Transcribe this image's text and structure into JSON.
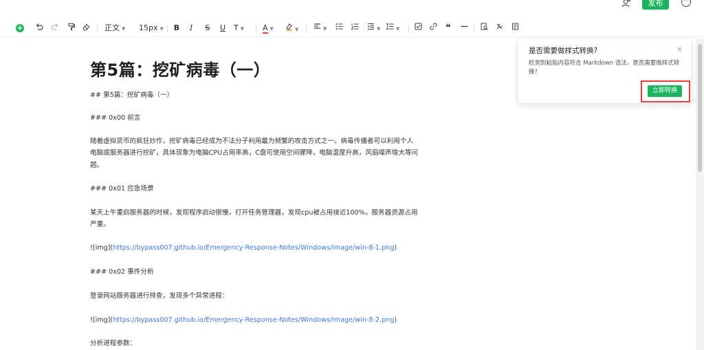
{
  "topbar": {
    "add_user_icon": "add-user-icon",
    "publish_label": "发布",
    "more_icon": "more-icon",
    "accent_color": "#1db45f"
  },
  "toolbar": {
    "insert_icon": "plus-circle-icon",
    "undo_icon": "undo-icon",
    "redo_icon": "redo-icon",
    "format_painter_icon": "format-painter-icon",
    "clear_format_icon": "eraser-icon",
    "paragraph_style": "正文",
    "font_size": "15px",
    "bold": "B",
    "italic": "I",
    "strikethrough": "S",
    "underline": "U",
    "text_effects": "T",
    "font_color": "A",
    "highlight_icon": "highlighter-icon",
    "align_icon": "align-left-icon",
    "bullet_list_icon": "bullet-list-icon",
    "numbered_list_icon": "numbered-list-icon",
    "indent_icon": "indent-icon",
    "line_height_icon": "line-height-icon",
    "task_icon": "checkbox-icon",
    "link_icon": "link-icon",
    "quote": "❝",
    "divider_icon": "horizontal-rule-icon",
    "search_icon": "search-doc-icon",
    "tools_icon": "tools-icon",
    "save_icon": "save-icon"
  },
  "document": {
    "title": "第5篇：挖矿病毒（一）",
    "paragraphs": [
      "## 第5篇：挖矿病毒（一）",
      "### 0x00 前言",
      " 随着虚拟货币的疯狂炒作，挖矿病毒已经成为不法分子利用最为频繁的攻击方式之一。病毒传播者可以利用个人",
      "电脑或服务器进行挖矿，具体现象为电脑CPU占用率高，C盘可使用空间骤降，电脑温度升高，风扇噪声增大等问",
      "题。",
      "### 0x01 应急场景",
      " 某天上午重启服务器的时候，发现程序启动很慢，打开任务管理器，发现cpu被占用接近100%，服务器资源占用",
      "严重。",
      "### 0x02 事件分析",
      " 登录网站服务器进行排查，发现多个异常进程：",
      "分析进程参数："
    ],
    "img_prefix": "![img](",
    "img_suffix": ")",
    "link1": "https://bypass007.github.io/Emergency-Response-Notes/Windows/image/win-8-1.png",
    "link2": "https://bypass007.github.io/Emergency-Response-Notes/Windows/image/win-8-2.png"
  },
  "popup": {
    "title": "是否需要做样式转换?",
    "close": "×",
    "message": "检测到粘贴内容符合 Markdown 语法，是否需要做样式转换?",
    "button": "立即转换",
    "highlight_color": "#e53b3b"
  }
}
